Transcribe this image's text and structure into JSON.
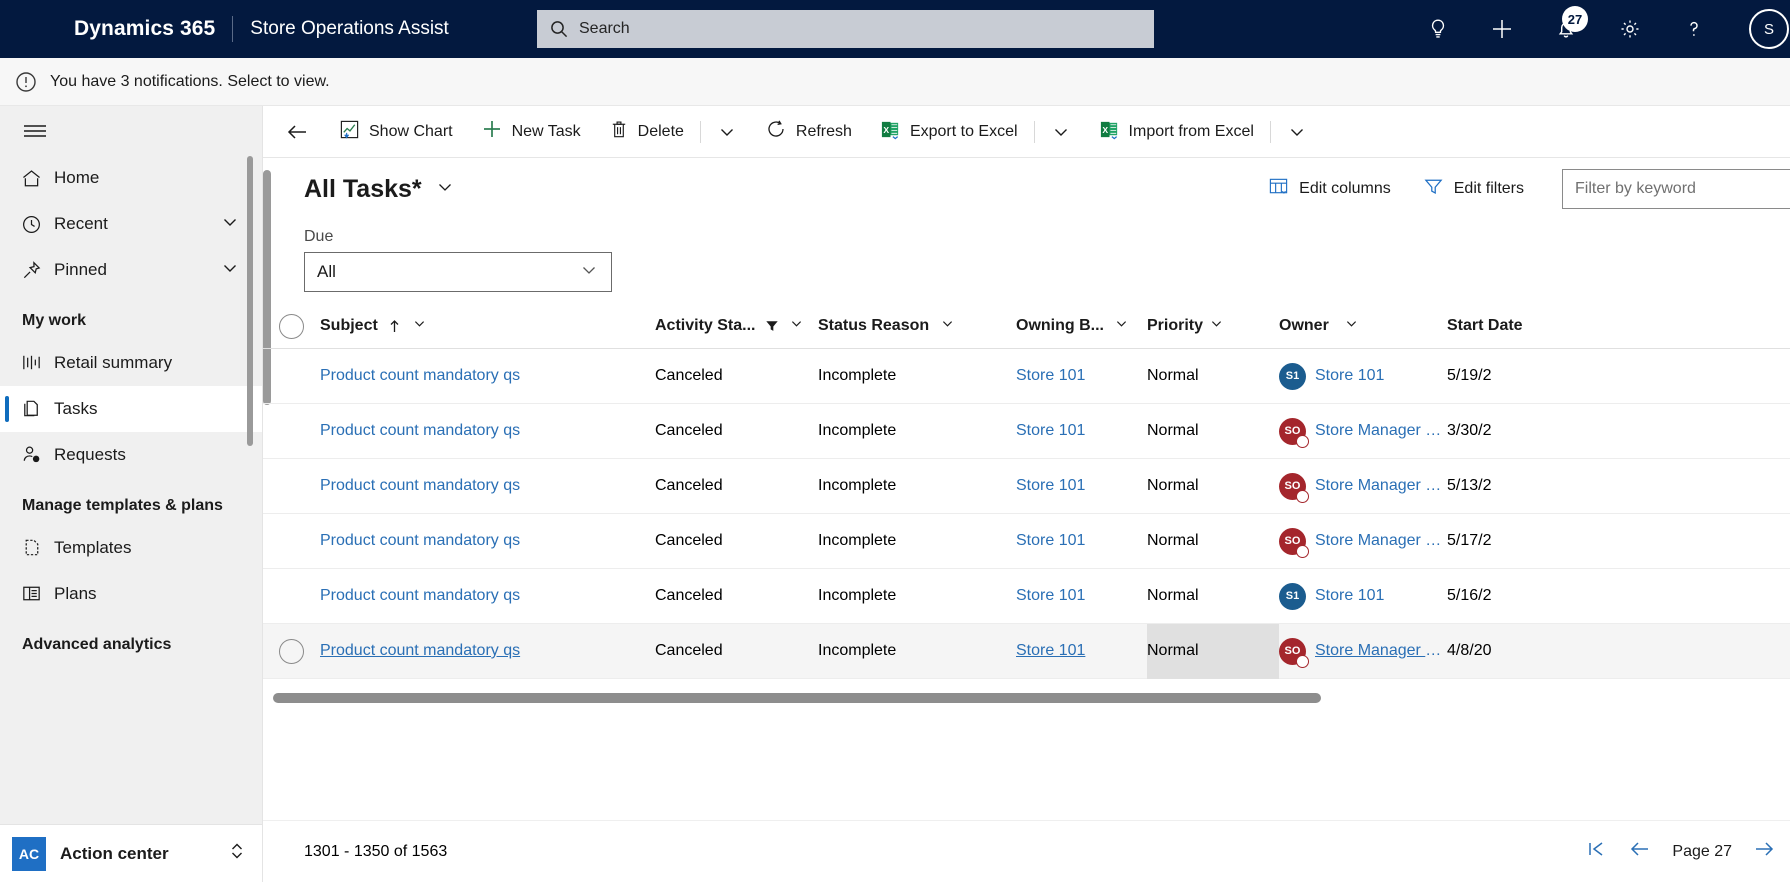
{
  "appbar": {
    "brand": "Dynamics 365",
    "app_name": "Store Operations Assist",
    "search_placeholder": "Search",
    "icons": {
      "lightbulb": "lightbulb-icon",
      "plus": "plus-icon",
      "bell": "bell-icon",
      "gear": "gear-icon",
      "help": "help-icon",
      "avatar": "user-avatar"
    },
    "notification_count": "27"
  },
  "notification_bar": {
    "message": "You have 3 notifications. Select to view."
  },
  "sidebar": {
    "items": [
      {
        "label": "Home",
        "icon": "home-icon",
        "expandable": false
      },
      {
        "label": "Recent",
        "icon": "clock-icon",
        "expandable": true
      },
      {
        "label": "Pinned",
        "icon": "pin-icon",
        "expandable": true
      }
    ],
    "groups": [
      {
        "title": "My work",
        "items": [
          {
            "label": "Retail summary",
            "icon": "chart-icon"
          },
          {
            "label": "Tasks",
            "icon": "task-icon"
          },
          {
            "label": "Requests",
            "icon": "person-question-icon"
          }
        ]
      },
      {
        "title": "Manage templates & plans",
        "items": [
          {
            "label": "Templates",
            "icon": "template-icon"
          },
          {
            "label": "Plans",
            "icon": "plans-icon"
          }
        ]
      },
      {
        "title": "Advanced analytics",
        "items": []
      }
    ],
    "selected": "Tasks",
    "action_center": {
      "badge": "AC",
      "label": "Action center"
    }
  },
  "commandbar": {
    "back": "back-arrow",
    "buttons": [
      {
        "label": "Show Chart",
        "icon": "chart-icon"
      },
      {
        "label": "New Task",
        "icon": "plus-icon"
      },
      {
        "label": "Delete",
        "icon": "trash-icon"
      },
      {
        "label": "Refresh",
        "icon": "refresh-icon"
      },
      {
        "label": "Export to Excel",
        "icon": "excel-icon"
      },
      {
        "label": "Import from Excel",
        "icon": "excel-icon"
      }
    ]
  },
  "view": {
    "title": "All Tasks*",
    "edit_columns": "Edit columns",
    "edit_filters": "Edit filters",
    "filter_placeholder": "Filter by keyword"
  },
  "due_filter": {
    "label": "Due",
    "value": "All"
  },
  "grid": {
    "columns": [
      {
        "key": "subject",
        "label": "Subject",
        "sorted": "asc",
        "filtered": false
      },
      {
        "key": "activity_status",
        "label": "Activity Sta...",
        "filtered": true
      },
      {
        "key": "status_reason",
        "label": "Status Reason",
        "filtered": false
      },
      {
        "key": "owning_business",
        "label": "Owning B...",
        "filtered": false
      },
      {
        "key": "priority",
        "label": "Priority",
        "filtered": false
      },
      {
        "key": "owner",
        "label": "Owner",
        "filtered": false
      },
      {
        "key": "start_date",
        "label": "Start Date",
        "filtered": false
      }
    ],
    "rows": [
      {
        "subject": "Product count mandatory qs",
        "activity_status": "Canceled",
        "status_reason": "Incomplete",
        "owning_business": "Store 101",
        "priority": "Normal",
        "owner": "Store 101",
        "owner_initials": "S1",
        "owner_color": "blue",
        "start_date": "5/19/2"
      },
      {
        "subject": "Product count mandatory qs",
        "activity_status": "Canceled",
        "status_reason": "Incomplete",
        "owning_business": "Store 101",
        "priority": "Normal",
        "owner": "Store Manager O...",
        "owner_initials": "SO",
        "owner_color": "red",
        "start_date": "3/30/2"
      },
      {
        "subject": "Product count mandatory qs",
        "activity_status": "Canceled",
        "status_reason": "Incomplete",
        "owning_business": "Store 101",
        "priority": "Normal",
        "owner": "Store Manager O...",
        "owner_initials": "SO",
        "owner_color": "red",
        "start_date": "5/13/2"
      },
      {
        "subject": "Product count mandatory qs",
        "activity_status": "Canceled",
        "status_reason": "Incomplete",
        "owning_business": "Store 101",
        "priority": "Normal",
        "owner": "Store Manager O...",
        "owner_initials": "SO",
        "owner_color": "red",
        "start_date": "5/17/2"
      },
      {
        "subject": "Product count mandatory qs",
        "activity_status": "Canceled",
        "status_reason": "Incomplete",
        "owning_business": "Store 101",
        "priority": "Normal",
        "owner": "Store 101",
        "owner_initials": "S1",
        "owner_color": "blue",
        "start_date": "5/16/2"
      },
      {
        "subject": "Product count mandatory qs",
        "activity_status": "Canceled",
        "status_reason": "Incomplete",
        "owning_business": "Store 101",
        "priority": "Normal",
        "owner": "Store Manager O...",
        "owner_initials": "SO",
        "owner_color": "red",
        "start_date": "4/8/20",
        "hovered": true
      }
    ]
  },
  "footer": {
    "record_range": "1301 - 1350 of 1563",
    "page_label": "Page 27"
  },
  "colors": {
    "header_bg": "#03193f",
    "accent_link": "#2a6fb5",
    "selection_bar": "#0f6cbd",
    "avatar_blue": "#1b5c8f",
    "avatar_red": "#a4262c",
    "excel_green": "#107c41"
  }
}
